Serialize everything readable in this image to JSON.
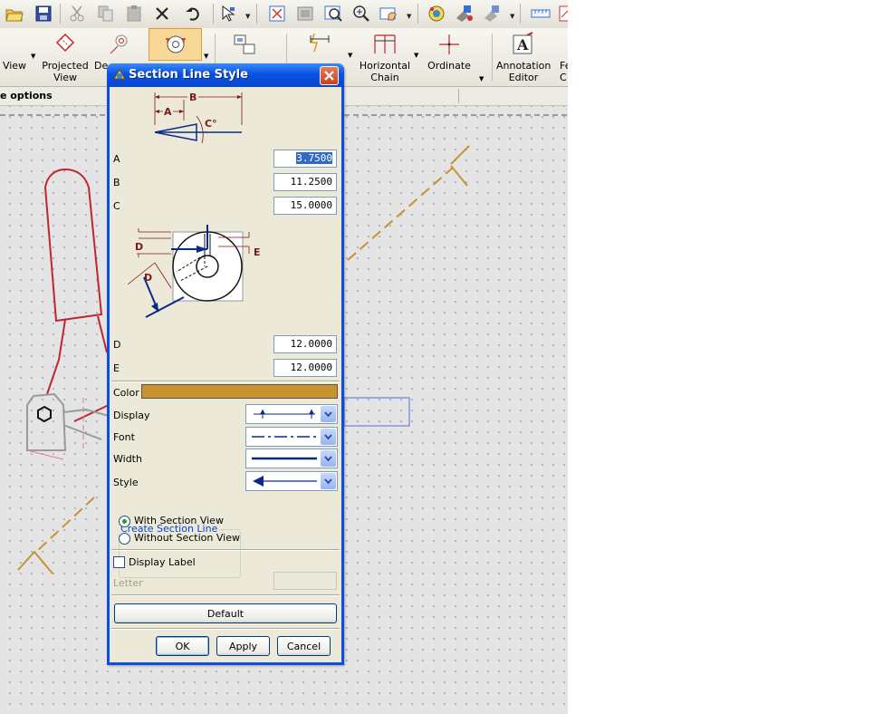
{
  "toolbar": {
    "icons": [
      "open-icon",
      "save-icon",
      "cut-icon",
      "copy-icon",
      "paste-icon",
      "delete-icon",
      "undo-icon",
      "select-icon",
      "zoom-area-icon",
      "zoom-fit-icon",
      "zoom-window-icon",
      "zoom-icon",
      "pan-icon",
      "refresh-icon",
      "render-icon",
      "render-options-icon",
      "measure-icon",
      "drawing-icon"
    ]
  },
  "ribbon": {
    "view_label": "View",
    "projected_label": "Projected\nView",
    "detail_label": "De",
    "horizontal_chain_label": "Horizontal\nChain",
    "ordinate_label": "Ordinate",
    "annotation_editor_label": "Annotation\nEditor",
    "feature_label": "Fe\nC"
  },
  "optbar": {
    "text": "e options"
  },
  "dialog": {
    "title": "Section Line Style",
    "fields": {
      "a_label": "A",
      "a_value": "3.7500",
      "b_label": "B",
      "b_value": "11.2500",
      "c_label": "C",
      "c_value": "15.0000",
      "d_label": "D",
      "d_value": "12.0000",
      "e_label": "E",
      "e_value": "12.0000"
    },
    "diagram1": {
      "a": "A",
      "b": "B",
      "c": "C°"
    },
    "diagram2": {
      "d": "D",
      "e": "E"
    },
    "color_label": "Color",
    "color_value": "#c8922f",
    "display_label": "Display",
    "font_label": "Font",
    "width_label": "Width",
    "style_label": "Style",
    "create_group_title": "Create Section Line",
    "radio_with": "With Section View",
    "radio_without": "Without Section View",
    "radio_selected": "with",
    "display_label_check": "Display Label",
    "display_label_checked": false,
    "letter_label": "Letter",
    "letter_value": "",
    "default_button": "Default",
    "ok_button": "OK",
    "apply_button": "Apply",
    "cancel_button": "Cancel"
  },
  "colors": {
    "sketch_red": "#c0272d",
    "section_line": "#c8922f",
    "title_blue": "#0a52e4"
  }
}
